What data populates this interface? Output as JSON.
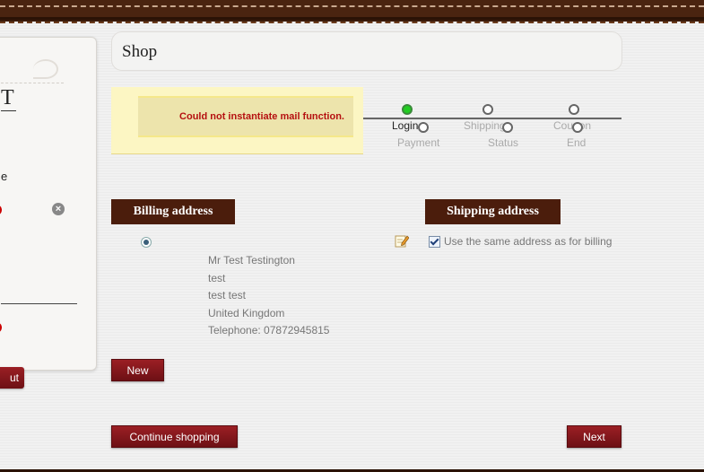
{
  "header": {
    "title": "Shop"
  },
  "sidebar": {
    "letter": "T",
    "line_letter": "e",
    "remove_icon": "close-circle-icon",
    "checkout_button": "ut"
  },
  "message": {
    "text": "Could not instantiate mail function."
  },
  "steps": [
    {
      "label": "Login",
      "active": true
    },
    {
      "label": "Payment",
      "active": false
    },
    {
      "label": "Shipping",
      "active": false
    },
    {
      "label": "Status",
      "active": false
    },
    {
      "label": "Coupon",
      "active": false
    },
    {
      "label": "End",
      "active": false
    }
  ],
  "billing": {
    "title": "Billing address",
    "address": {
      "name": "Mr Test Testington",
      "line1": "test",
      "line2": "test test",
      "country": "United Kingdom",
      "telephone": "Telephone: 07872945815"
    },
    "new_button": "New"
  },
  "shipping": {
    "title": "Shipping address",
    "same_address_label": "Use the same address as for billing",
    "same_address_checked": true
  },
  "footer": {
    "continue_button": "Continue shopping",
    "next_button": "Next"
  },
  "colors": {
    "section_title_bg": "#4b1d0c",
    "button_bg": "#8a1a1f",
    "error_text": "#b51010",
    "active_step": "#22cc22"
  }
}
